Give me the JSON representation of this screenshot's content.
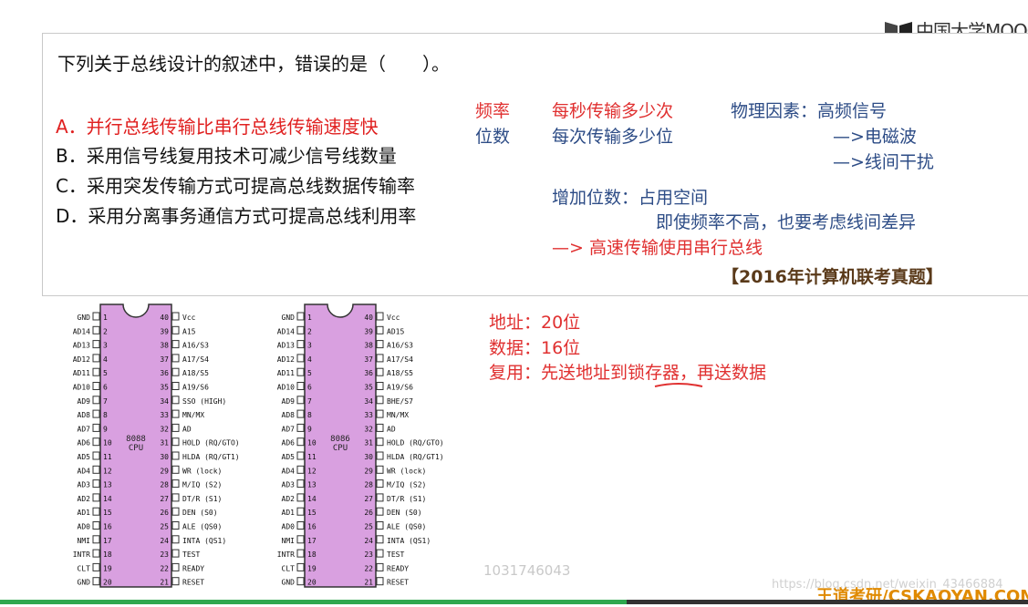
{
  "brand": {
    "logo_text": "中国大学MOOC",
    "footer": "王道考研/CSKAOYAN.COM",
    "watermark_id": "1031746043",
    "watermark_url": "https://blog.csdn.net/weixin_43466884"
  },
  "question": {
    "stem": "下列关于总线设计的叙述中，错误的是（　　）。",
    "options": [
      "A．并行总线传输比串行总线传输速度快",
      "B．采用信号线复用技术可减少信号线数量",
      "C．采用突发传输方式可提高总线数据传输率",
      "D．采用分离事务通信方式可提高总线利用率"
    ],
    "wrong_option_color": "#e02020"
  },
  "notes": {
    "freq_label": "频率",
    "freq_desc": "每秒传输多少次",
    "bits_label": "位数",
    "bits_desc": "每次传输多少位",
    "physical": "物理因素：高频信号",
    "em_wave": "—>电磁波",
    "crosstalk": "—>线间干扰",
    "add_bits": "增加位数：占用空间",
    "diff": "即使频率不高，也要考虑线间差异",
    "conclusion": "—> 高速传输使用串行总线",
    "source": "【2016年计算机联考真题】"
  },
  "memory_notes": {
    "address": "地址：20位",
    "data": "数据：16位",
    "multiplex": "复用：先送地址到锁存器，再送数据"
  },
  "chips": [
    {
      "name": "8088\nCPU",
      "left_pins": [
        "GND",
        "AD14",
        "AD13",
        "AD12",
        "AD11",
        "AD10",
        "AD9",
        "AD8",
        "AD7",
        "AD6",
        "AD5",
        "AD4",
        "AD3",
        "AD2",
        "AD1",
        "AD0",
        "NMI",
        "INTR",
        "CLT",
        "GND"
      ],
      "right_pins": [
        "Vcc",
        "A15",
        "A16/S3",
        "A17/S4",
        "A18/S5",
        "A19/S6",
        "SSO (HIGH)",
        "MN/MX",
        "AD",
        "HOLD (RQ/GTO)",
        "HLDA (RQ/GT1)",
        "WR (lock)",
        "M/IQ (S2)",
        "DT/R (S1)",
        "DEN (S0)",
        "ALE (QS0)",
        "INTA (QS1)",
        "TEST",
        "READY",
        "RESET"
      ]
    },
    {
      "name": "8086\nCPU",
      "left_pins": [
        "GND",
        "AD14",
        "AD13",
        "AD12",
        "AD11",
        "AD10",
        "AD9",
        "AD8",
        "AD7",
        "AD6",
        "AD5",
        "AD4",
        "AD3",
        "AD2",
        "AD1",
        "AD0",
        "NMI",
        "INTR",
        "CLT",
        "GND"
      ],
      "right_pins": [
        "Vcc",
        "AD15",
        "A16/S3",
        "A17/S4",
        "A18/S5",
        "A19/S6",
        "BHE/S7",
        "MN/MX",
        "AD",
        "HOLD (RQ/GTO)",
        "HLDA (RQ/GT1)",
        "WR (lock)",
        "M/IQ (S2)",
        "DT/R (S1)",
        "DEN (S0)",
        "ALE (QS0)",
        "INTA (QS1)",
        "TEST",
        "READY",
        "RESET"
      ]
    }
  ],
  "colors": {
    "chip_fill": "#d9a0e0",
    "chip_stroke": "#333333",
    "progress": "#2fa84f"
  },
  "progress": {
    "fraction": 0.61
  }
}
